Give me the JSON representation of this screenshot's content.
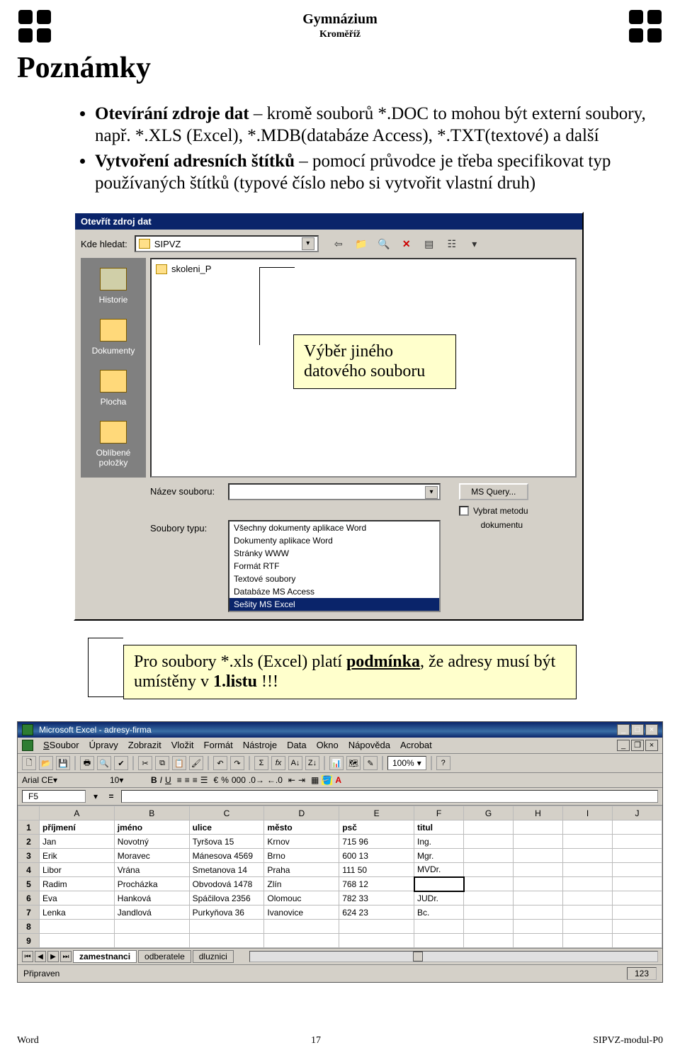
{
  "header": {
    "school": "Gymnázium",
    "city": "Kroměříž"
  },
  "title": "Poznámky",
  "bullets": [
    {
      "bold": "Otevírání zdroje dat",
      "rest": " – kromě souborů *.DOC to mohou být externí soubory, např. *.XLS (Excel), *.MDB(databáze Access), *.TXT(textové) a další"
    },
    {
      "bold": "Vytvoření adresních štítků",
      "rest": " – pomocí průvodce je třeba specifikovat typ používaných štítků (typové číslo nebo si vytvořit vlastní druh)"
    }
  ],
  "dialog": {
    "title": "Otevřít zdroj dat",
    "lookin_label": "Kde hledat:",
    "lookin_value": "SIPVZ",
    "list_item": "skoleni_P",
    "places": [
      "Historie",
      "Dokumenty",
      "Plocha",
      "Oblíbené položky"
    ],
    "name_label": "Název souboru:",
    "type_label": "Soubory typu:",
    "type_options": [
      "Všechny dokumenty aplikace Word",
      "Dokumenty aplikace Word",
      "Stránky WWW",
      "Formát RTF",
      "Textové soubory",
      "Databáze MS Access",
      "Sešity MS Excel"
    ],
    "type_selected_index": 6,
    "btn_msquery": "MS Query...",
    "chk_method": "Vybrat metodu",
    "partial_right": "dokumentu"
  },
  "callout1": {
    "l1": "Výběr jiného",
    "l2": "datového souboru"
  },
  "callout2": {
    "pre": "Pro soubory *.xls (Excel) platí ",
    "u": "podmínka",
    "mid": ", že adresy musí být umístěny v ",
    "b": "1.listu",
    "post": " !!!"
  },
  "excel": {
    "title": "Microsoft Excel - adresy-firma",
    "menu": [
      "Soubor",
      "Úpravy",
      "Zobrazit",
      "Vložit",
      "Formát",
      "Nástroje",
      "Data",
      "Okno",
      "Nápověda",
      "Acrobat"
    ],
    "font": "Arial CE",
    "font_size": "10",
    "zoom": "100%",
    "cellref": "F5",
    "cols": [
      "A",
      "B",
      "C",
      "D",
      "E",
      "F",
      "G",
      "H",
      "I",
      "J"
    ],
    "headers": [
      "příjmení",
      "jméno",
      "ulice",
      "město",
      "psč",
      "titul"
    ],
    "rows": [
      [
        "Jan",
        "Novotný",
        "Tyršova 15",
        "Krnov",
        "715 96",
        "Ing."
      ],
      [
        "Erik",
        "Moravec",
        "Mánesova 4569",
        "Brno",
        "600 13",
        "Mgr."
      ],
      [
        "Libor",
        "Vrána",
        "Smetanova 14",
        "Praha",
        "111 50",
        "MVDr."
      ],
      [
        "Radim",
        "Procházka",
        "Obvodová 1478",
        "Zlín",
        "768 12",
        ""
      ],
      [
        "Eva",
        "Hanková",
        "Spáčilova 2356",
        "Olomouc",
        "782 33",
        "JUDr."
      ],
      [
        "Lenka",
        "Jandlová",
        "Purkyňova 36",
        "Ivanovice",
        "624 23",
        "Bc."
      ]
    ],
    "tabs": [
      "zamestnanci",
      "odberatele",
      "dluznici"
    ],
    "status": "Připraven",
    "status_num": "123"
  },
  "footer": {
    "left": "Word",
    "center": "17",
    "right": "SIPVZ-modul-P0"
  }
}
